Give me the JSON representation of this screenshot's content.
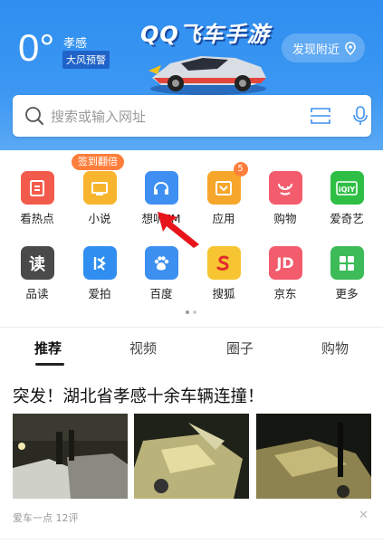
{
  "weather": {
    "temp": "0°",
    "city": "孝感",
    "alert": "大风预警"
  },
  "banner": {
    "title": "QQ飞车手游"
  },
  "discover": {
    "label": "发现附近"
  },
  "search": {
    "placeholder": "搜索或输入网址"
  },
  "promo": {
    "label": "签到翻倍"
  },
  "apps": [
    {
      "label": "看热点",
      "color": "#f25b4b",
      "icon": "hot-news-icon"
    },
    {
      "label": "小说",
      "color": "#f7b52e",
      "icon": "novel-icon"
    },
    {
      "label": "想听FM",
      "color": "#3f8ff2",
      "icon": "headphone-icon"
    },
    {
      "label": "应用",
      "color": "#f6a62a",
      "icon": "app-store-icon",
      "badge": "5"
    },
    {
      "label": "购物",
      "color": "#f25c6d",
      "icon": "shopping-icon"
    },
    {
      "label": "爱奇艺",
      "color": "#2fbf45",
      "icon": "iqiyi-icon"
    },
    {
      "label": "品读",
      "color": "#4a4a4a",
      "icon": "reading-icon",
      "glyph": "读"
    },
    {
      "label": "爱拍",
      "color": "#2f8ef0",
      "icon": "aipai-icon"
    },
    {
      "label": "百度",
      "color": "#3d8ff0",
      "icon": "baidu-paw-icon"
    },
    {
      "label": "搜狐",
      "color": "#f6c531",
      "icon": "sohu-icon"
    },
    {
      "label": "京东",
      "color": "#f25c6d",
      "icon": "jd-icon",
      "glyph": "JD"
    },
    {
      "label": "更多",
      "color": "#3dbb59",
      "icon": "more-grid-icon"
    }
  ],
  "tabs": [
    "推荐",
    "视频",
    "圈子",
    "购物"
  ],
  "news": {
    "title": "突发！湖北省孝感十余车辆连撞！",
    "source": "爱车一点",
    "comments": "12评"
  }
}
